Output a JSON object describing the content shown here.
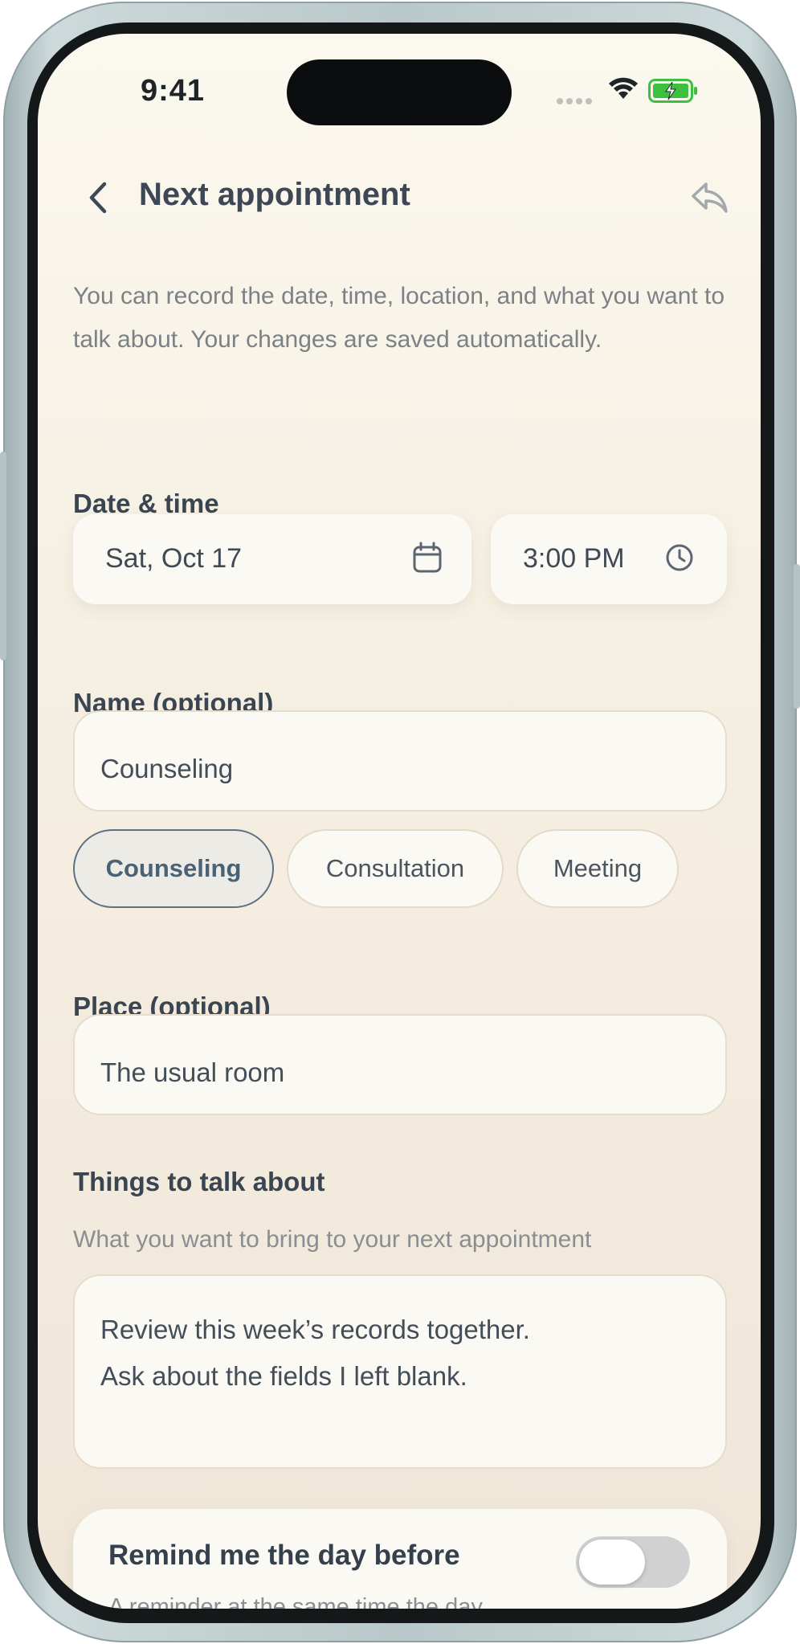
{
  "status_bar": {
    "time": "9:41",
    "icons": [
      "cellular-icon",
      "wifi-icon",
      "battery-charging-icon"
    ],
    "battery_color": "#3fbf3f"
  },
  "header": {
    "title": "Next appointment",
    "back_icon": "chevron-left-icon",
    "share_icon": "reply-icon"
  },
  "intro": "You can record the date, time, location, and what you want to talk about. Your changes are saved automatically.",
  "date_time": {
    "label": "Date & time",
    "date": "Sat, Oct 17",
    "date_icon": "calendar-icon",
    "time": "3:00 PM",
    "time_icon": "clock-icon"
  },
  "name": {
    "label": "Name (optional)",
    "value": "Counseling",
    "suggestions": [
      {
        "label": "Counseling",
        "selected": true
      },
      {
        "label": "Consultation",
        "selected": false
      },
      {
        "label": "Meeting",
        "selected": false
      }
    ]
  },
  "place": {
    "label": "Place (optional)",
    "value": "The usual room"
  },
  "topics": {
    "label": "Things to talk about",
    "helper": "What you want to bring to your next appointment",
    "lines": [
      "Review this week’s records together.",
      "Ask about the fields I left blank."
    ]
  },
  "reminder": {
    "title": "Remind me the day before",
    "subtitle": "A reminder at the same time the day",
    "enabled": false
  },
  "colors": {
    "accent": "#5d7183",
    "background": "#f5efe2",
    "card": "#fbf9f4"
  }
}
